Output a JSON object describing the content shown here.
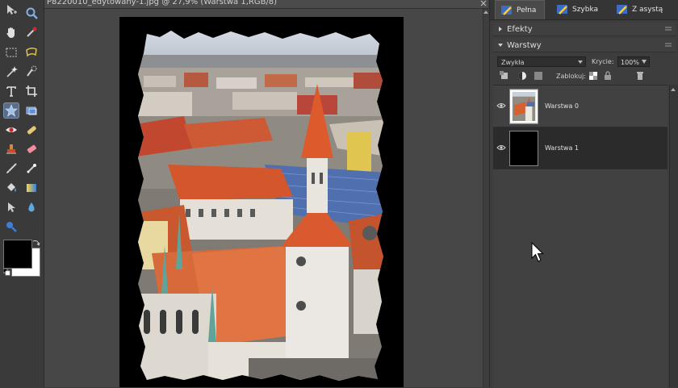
{
  "document": {
    "title": "P8220010_edytowany-1.jpg @ 27,9% (Warstwa 1,RGB/8)"
  },
  "toolbox": {
    "tools": [
      "move-icon",
      "zoom-icon",
      "hand-icon",
      "eyedropper-icon",
      "rect-marquee-icon",
      "lasso-icon",
      "magic-wand-icon",
      "quick-selection-icon",
      "type-icon",
      "crop-icon",
      "cookie-cutter-icon",
      "straighten-icon",
      "red-eye-icon",
      "spot-healing-icon",
      "clone-stamp-icon",
      "eraser-icon",
      "brush-icon",
      "smart-brush-icon",
      "paint-bucket-icon",
      "gradient-icon",
      "custom-shape-icon",
      "blur-icon",
      "sponge-icon"
    ],
    "foreground_color": "#000000",
    "background_color": "#ffffff"
  },
  "panel": {
    "mode_tabs": [
      {
        "label": "Pełna",
        "active": true
      },
      {
        "label": "Szybka",
        "active": false
      },
      {
        "label": "Z asystą",
        "active": false
      }
    ],
    "effects_label": "Efekty",
    "layers_label": "Warstwy",
    "blend_mode": "Zwykła",
    "opacity_label": "Krycie:",
    "opacity_value": "100%",
    "lock_label": "Zablokuj:",
    "layers": [
      {
        "name": "Warstwa 0",
        "selected": false
      },
      {
        "name": "Warstwa 1",
        "selected": true
      }
    ]
  },
  "colors": {
    "accent": "#5a6c86",
    "panel_bg": "#3d3d3d",
    "canvas_bg": "#474747"
  }
}
